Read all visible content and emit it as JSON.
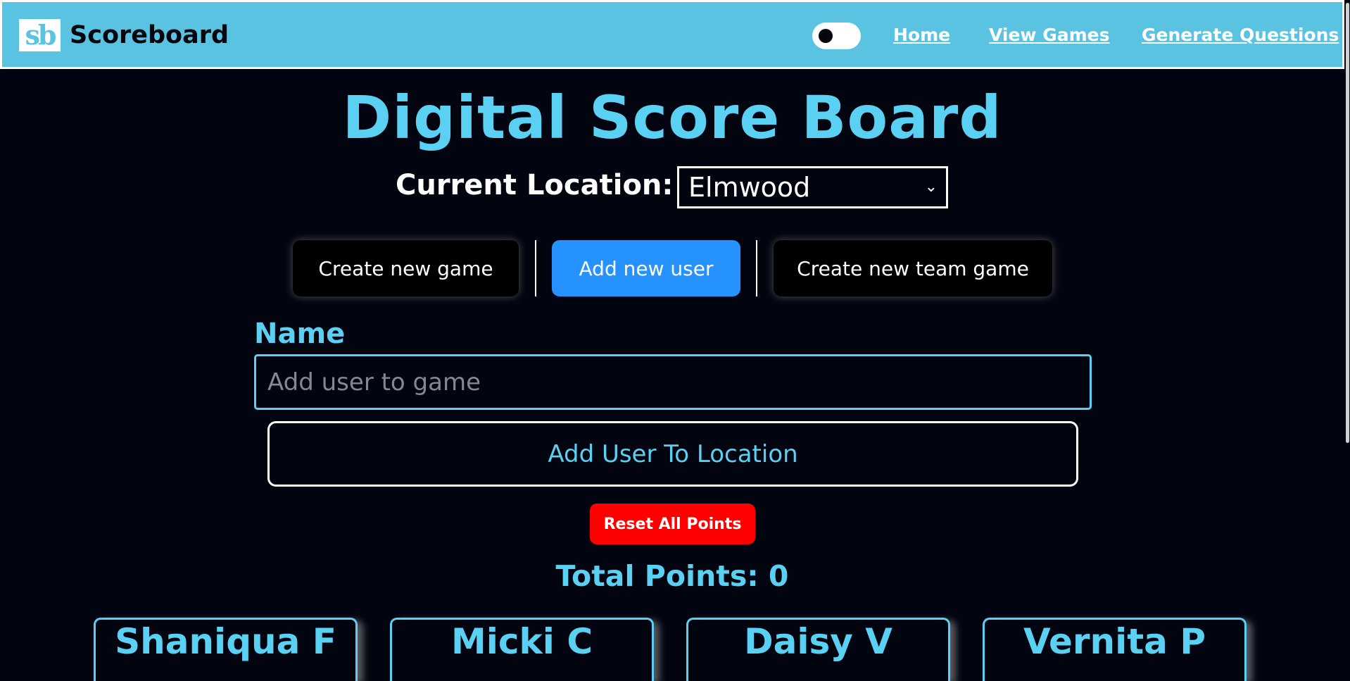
{
  "navbar": {
    "logo_text": "sb",
    "brand": "Scoreboard",
    "links": [
      "Home",
      "View Games",
      "Generate Questions"
    ],
    "theme_toggle": "off"
  },
  "main": {
    "title": "Digital Score Board",
    "location_label": "Current Location:",
    "location_value": "Elmwood",
    "mode_buttons": [
      "Create new game",
      "Add new user",
      "Create new team game"
    ],
    "active_mode": "Add new user",
    "name_label": "Name",
    "name_placeholder": "Add user to game",
    "add_user_button": "Add User To Location",
    "reset_button": "Reset All Points",
    "total_points": "Total Points: 0"
  },
  "users": [
    "Shaniqua F",
    "Micki C",
    "Daisy V",
    "Vernita P"
  ],
  "colors": {
    "navbar_bg": "#5ac3e2",
    "accent": "#5ad0f2",
    "active_button": "#2592ff",
    "reset": "#ff0000",
    "page_bg": "#02040f"
  }
}
